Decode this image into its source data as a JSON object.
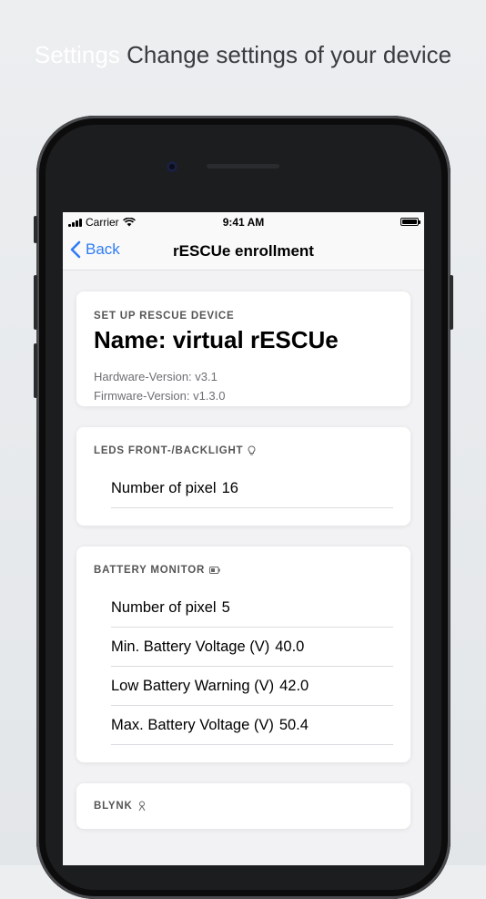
{
  "headline": {
    "strong": "Settings",
    "rest": "Change settings of your device"
  },
  "status_bar": {
    "carrier": "Carrier",
    "time": "9:41 AM"
  },
  "nav": {
    "back_label": "Back",
    "title": "rESCUe enrollment"
  },
  "device_card": {
    "header": "SET UP RESCUE DEVICE",
    "name": "Name: virtual rESCUe",
    "hardware": "Hardware-Version: v3.1",
    "firmware": "Firmware-Version: v1.3.0"
  },
  "leds_card": {
    "header": "LEDS FRONT-/BACKLIGHT",
    "icon": "lightbulb-icon",
    "rows": [
      {
        "label": "Number of pixel",
        "value": "16"
      }
    ]
  },
  "battery_card": {
    "header": "BATTERY MONITOR",
    "icon": "battery-icon",
    "rows": [
      {
        "label": "Number of pixel",
        "value": "5"
      },
      {
        "label": "Min. Battery Voltage (V)",
        "value": "40.0"
      },
      {
        "label": "Low Battery Warning (V)",
        "value": "42.0"
      },
      {
        "label": "Max. Battery Voltage (V)",
        "value": "50.4"
      }
    ]
  },
  "blynk_card": {
    "header": "BLYNK",
    "icon": "blynk-icon"
  },
  "colors": {
    "accent": "#2f7cf6",
    "background": "#f2f2f4"
  }
}
